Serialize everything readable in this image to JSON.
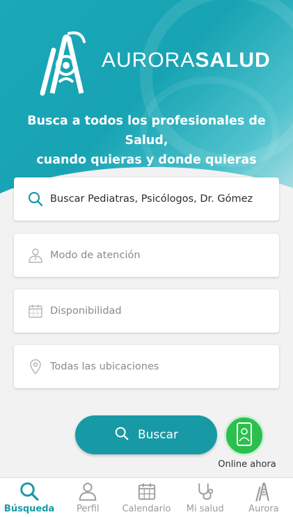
{
  "brand": {
    "part1": "AURORA",
    "part2": "SALUD"
  },
  "tagline": {
    "line1": "Busca a todos los profesionales de Salud,",
    "line2": "cuando quieras y donde quieras"
  },
  "fields": {
    "search": {
      "text": "Buscar Pediatras, Psicólogos, Dr. Gómez",
      "icon": "search-icon"
    },
    "mode": {
      "placeholder": "Modo de atención",
      "icon": "doctor-icon"
    },
    "availability": {
      "placeholder": "Disponibilidad",
      "icon": "calendar-icon"
    },
    "location": {
      "placeholder": "Todas las ubicaciones",
      "icon": "location-pin-icon"
    }
  },
  "search_button": {
    "label": "Buscar"
  },
  "online": {
    "label": "Online ahora"
  },
  "nav": {
    "items": [
      {
        "label": "Búsqueda",
        "icon": "search-icon",
        "active": true
      },
      {
        "label": "Perfil",
        "icon": "user-icon",
        "active": false
      },
      {
        "label": "Calendario",
        "icon": "calendar-icon",
        "active": false
      },
      {
        "label": "Mi salud",
        "icon": "stethoscope-icon",
        "active": false
      },
      {
        "label": "Aurora",
        "icon": "aurora-logo-icon",
        "active": false
      }
    ]
  },
  "colors": {
    "primary": "#189aa6",
    "online_green": "#2bbf4e",
    "hero": "#1aa9b8"
  }
}
